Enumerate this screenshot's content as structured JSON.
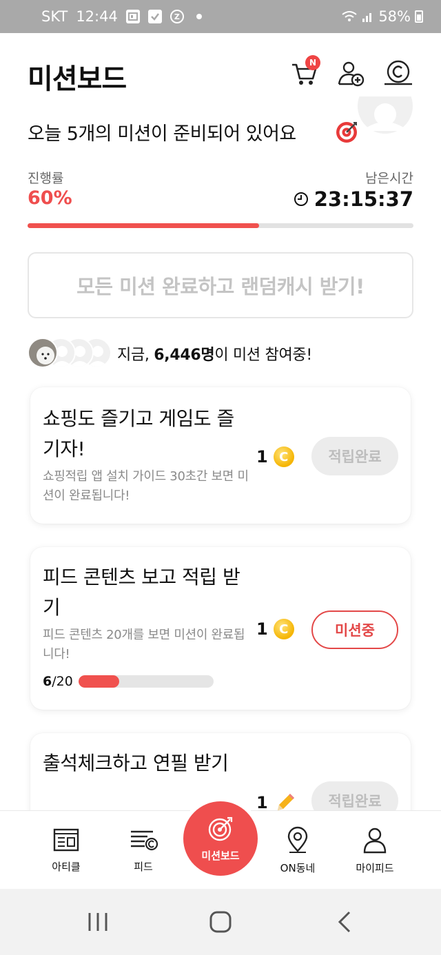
{
  "status_bar": {
    "carrier": "SKT",
    "time": "12:44",
    "notif_icons": [
      "nav-icon",
      "checkbox-icon",
      "z-icon"
    ],
    "battery": "58%"
  },
  "header": {
    "title": "미션보드",
    "cart_badge": "N"
  },
  "headline": "오늘 5개의 미션이 준비되어 있어요",
  "progress": {
    "label": "진행률",
    "value_text": "60%",
    "fraction": 0.6
  },
  "remaining": {
    "label": "남은시간",
    "time": "23:15:37"
  },
  "reward_banner": "모든 미션 완료하고 랜덤캐시 받기!",
  "participants": {
    "prefix": "지금, ",
    "count": "6,446명",
    "suffix": "이 미션 참여중!"
  },
  "missions": [
    {
      "title": "쇼핑도 즐기고 게임도 즐기자!",
      "description": "쇼핑적립 앱 설치 가이드 30초간 보면 미션이 완료됩니다!",
      "reward": "1",
      "reward_icon": "coin-icon",
      "status": "적립완료"
    },
    {
      "title": "피드 콘텐츠 보고 적립 받기",
      "description": "피드 콘텐츠 20개를 보면 미션이 완료됩니다!",
      "reward": "1",
      "reward_icon": "coin-icon",
      "status": "미션중",
      "progress_current": "6",
      "progress_total": "/20",
      "progress_fraction": 0.3
    },
    {
      "title": "출석체크하고 연필 받기",
      "reward": "1",
      "reward_icon": "pencil-icon",
      "status": "적립완료"
    }
  ],
  "bottom_nav": [
    {
      "label": "아티클",
      "icon": "article-icon"
    },
    {
      "label": "피드",
      "icon": "feed-icon"
    },
    {
      "label": "미션보드",
      "icon": "target-icon"
    },
    {
      "label": "ON동네",
      "icon": "location-pin-icon"
    },
    {
      "label": "마이피드",
      "icon": "person-icon"
    }
  ],
  "colors": {
    "accent": "#ef4e4e",
    "coin": "#f5b400",
    "status_bar": "#a9a9a9"
  }
}
